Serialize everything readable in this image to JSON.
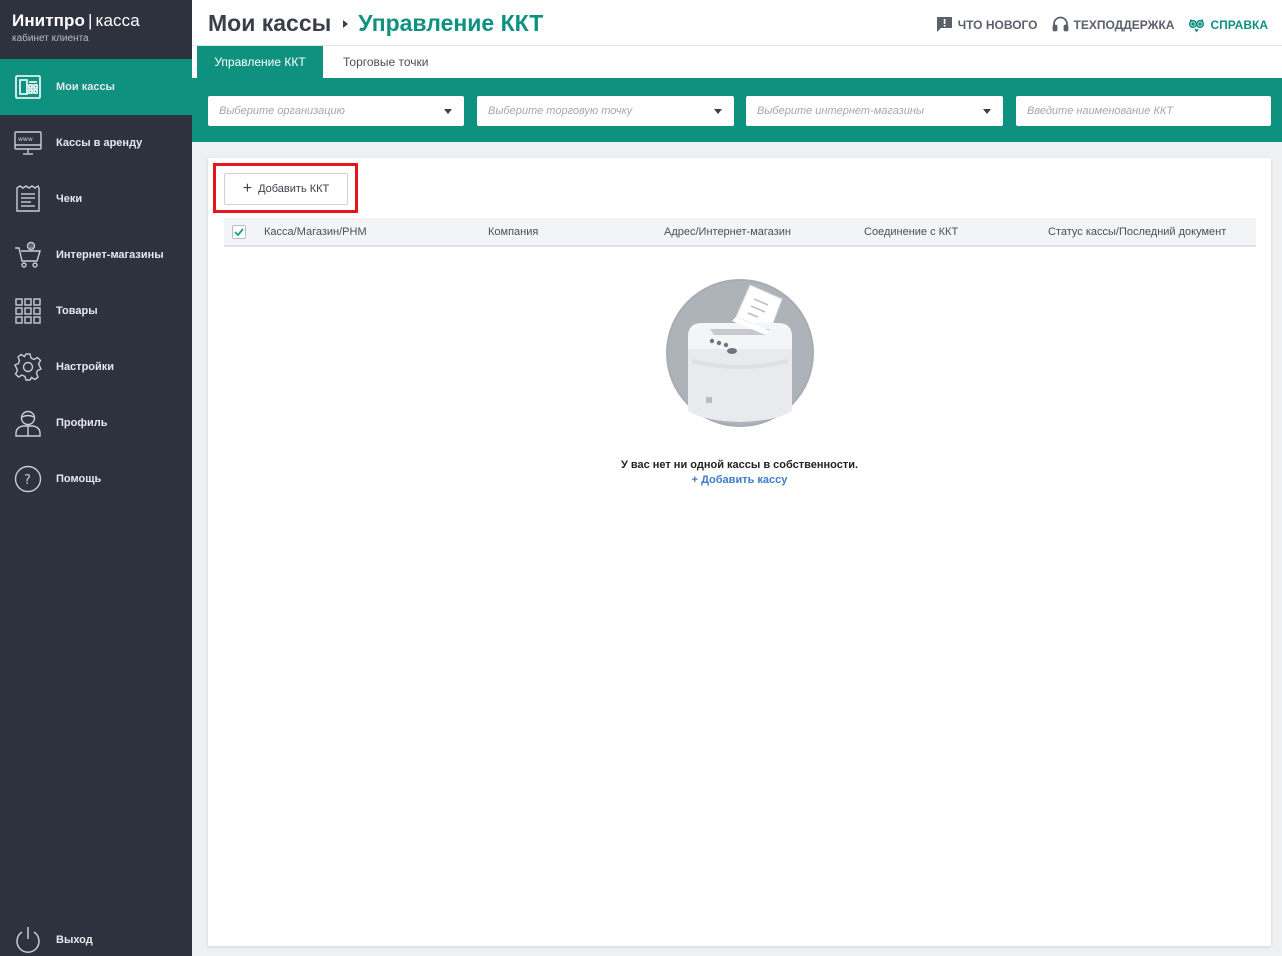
{
  "brand": {
    "name": "Инитпро",
    "separator": "|",
    "product": "касса",
    "subtitle": "кабинет клиента"
  },
  "sidebar": {
    "items": [
      {
        "label": "Мои кассы",
        "icon": "register-icon",
        "active": true
      },
      {
        "label": "Кассы в аренду",
        "icon": "www-monitor-icon",
        "active": false
      },
      {
        "label": "Чеки",
        "icon": "receipt-icon",
        "active": false
      },
      {
        "label": "Интернет-магазины",
        "icon": "shopping-cart-icon",
        "active": false
      },
      {
        "label": "Товары",
        "icon": "grid-icon",
        "active": false
      },
      {
        "label": "Настройки",
        "icon": "gear-icon",
        "active": false
      },
      {
        "label": "Профиль",
        "icon": "user-icon",
        "active": false
      },
      {
        "label": "Помощь",
        "icon": "help-icon",
        "active": false
      }
    ],
    "logout": {
      "label": "Выход",
      "icon": "power-icon"
    }
  },
  "header": {
    "breadcrumb_root": "Мои кассы",
    "breadcrumb_current": "Управление ККТ",
    "links": {
      "whats_new": "ЧТО НОВОГО",
      "support": "ТЕХПОДДЕРЖКА",
      "help": "СПРАВКА"
    }
  },
  "tabs": [
    {
      "label": "Управление ККТ",
      "active": true
    },
    {
      "label": "Торговые точки",
      "active": false
    }
  ],
  "filters": {
    "organization": "Выберите организацию",
    "outlet": "Выберите торговую точку",
    "webshop": "Выберите интернет-магазины",
    "kkt_name": "Введите наименование ККТ"
  },
  "toolbar": {
    "add_label": "Добавить ККТ"
  },
  "table": {
    "columns": [
      "Касса/Магазин/РНМ",
      "Компания",
      "Адрес/Интернет-магазин",
      "Соединение с ККТ",
      "Статус кассы/Последний документ"
    ],
    "select_all_checked": true
  },
  "empty": {
    "message": "У вас нет ни одной кассы в собственности.",
    "action": "+ Добавить кассу"
  },
  "colors": {
    "accent": "#0f9180",
    "sidebar": "#2e323e",
    "link": "#3e7ccc",
    "highlight": "#e3181f"
  }
}
